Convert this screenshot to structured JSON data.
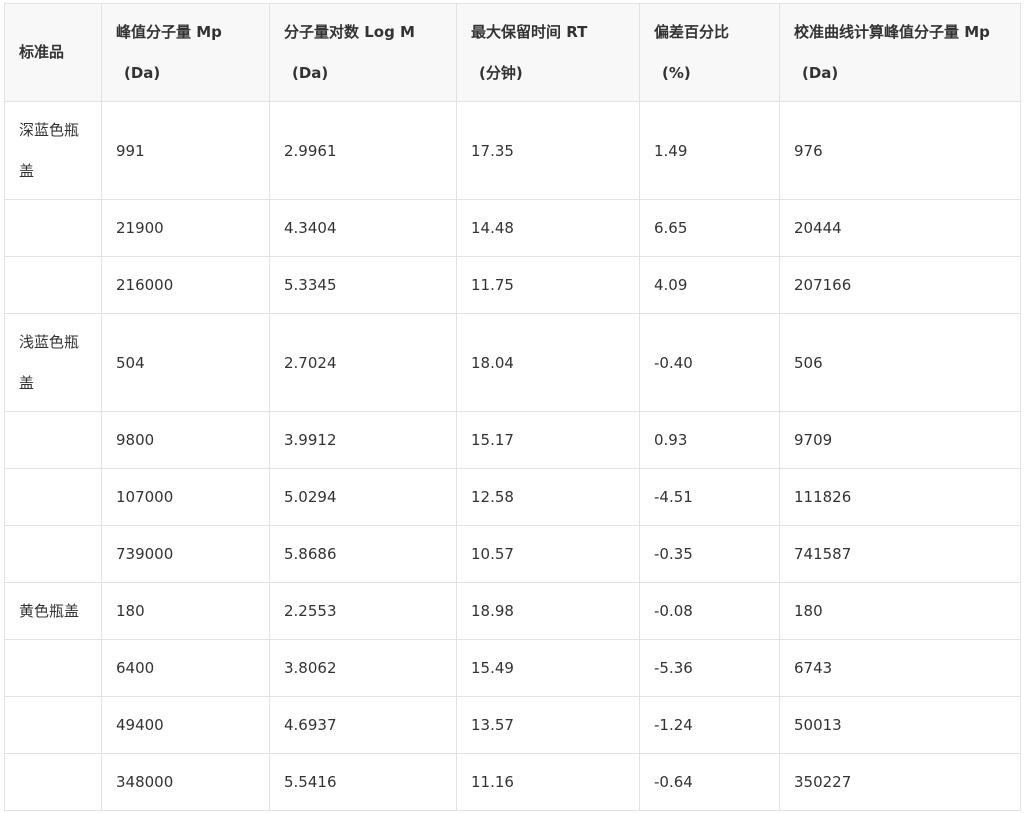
{
  "table": {
    "headers": [
      {
        "label": "标准品",
        "unit": ""
      },
      {
        "label": "峰值分子量 Mp",
        "unit": "(Da)"
      },
      {
        "label": "分子量对数 Log M",
        "unit": "(Da)"
      },
      {
        "label": "最大保留时间 RT",
        "unit": "(分钟)"
      },
      {
        "label": "偏差百分比",
        "unit": "(%)"
      },
      {
        "label": "校准曲线计算峰值分子量 Mp",
        "unit": "(Da)"
      }
    ],
    "rows": [
      {
        "standard": "深蓝色瓶盖",
        "mp": "991",
        "logm": "2.9961",
        "rt": "17.35",
        "dev": "1.49",
        "calc": "976"
      },
      {
        "standard": "",
        "mp": "21900",
        "logm": "4.3404",
        "rt": "14.48",
        "dev": "6.65",
        "calc": "20444"
      },
      {
        "standard": "",
        "mp": "216000",
        "logm": "5.3345",
        "rt": "11.75",
        "dev": "4.09",
        "calc": "207166"
      },
      {
        "standard": "浅蓝色瓶盖",
        "mp": "504",
        "logm": "2.7024",
        "rt": "18.04",
        "dev": "-0.40",
        "calc": "506"
      },
      {
        "standard": "",
        "mp": "9800",
        "logm": "3.9912",
        "rt": "15.17",
        "dev": "0.93",
        "calc": "9709"
      },
      {
        "standard": "",
        "mp": "107000",
        "logm": "5.0294",
        "rt": "12.58",
        "dev": "-4.51",
        "calc": "111826"
      },
      {
        "standard": "",
        "mp": "739000",
        "logm": "5.8686",
        "rt": "10.57",
        "dev": "-0.35",
        "calc": "741587"
      },
      {
        "standard": "黄色瓶盖",
        "mp": "180",
        "logm": "2.2553",
        "rt": "18.98",
        "dev": "-0.08",
        "calc": "180"
      },
      {
        "standard": "",
        "mp": "6400",
        "logm": "3.8062",
        "rt": "15.49",
        "dev": "-5.36",
        "calc": "6743"
      },
      {
        "standard": "",
        "mp": "49400",
        "logm": "4.6937",
        "rt": "13.57",
        "dev": "-1.24",
        "calc": "50013"
      },
      {
        "standard": "",
        "mp": "348000",
        "logm": "5.5416",
        "rt": "11.16",
        "dev": "-0.64",
        "calc": "350227"
      }
    ]
  }
}
